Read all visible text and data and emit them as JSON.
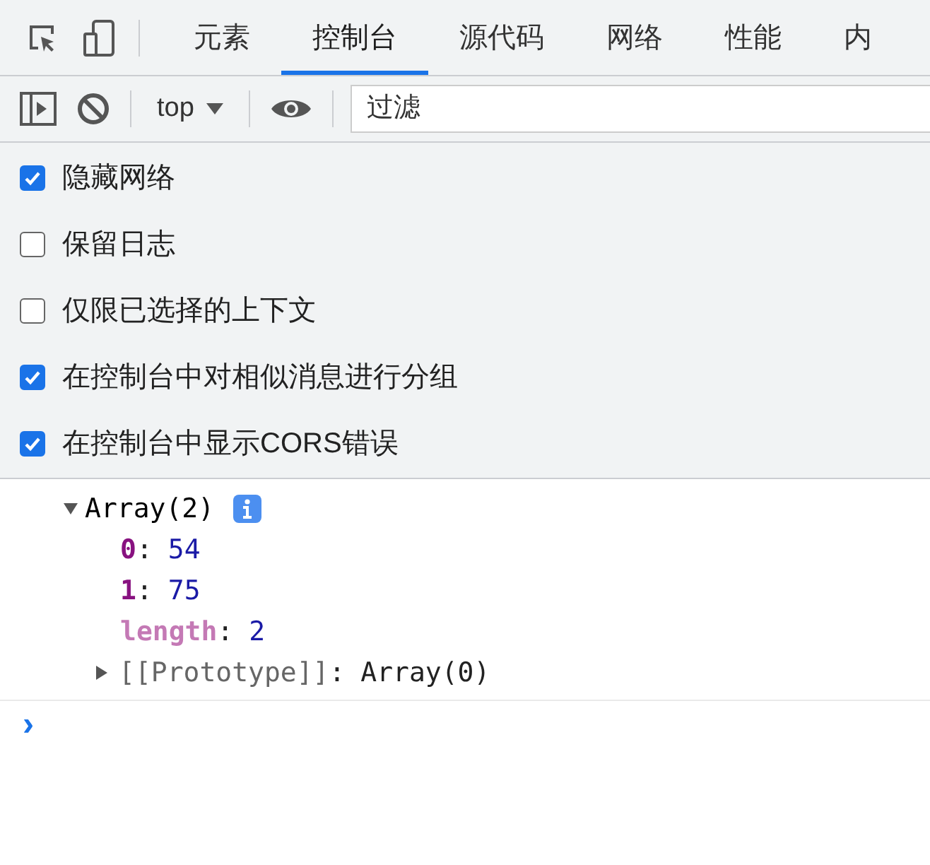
{
  "tabs": [
    {
      "label": "元素",
      "selected": false
    },
    {
      "label": "控制台",
      "selected": true
    },
    {
      "label": "源代码",
      "selected": false
    },
    {
      "label": "网络",
      "selected": false
    },
    {
      "label": "性能",
      "selected": false
    },
    {
      "label": "内",
      "selected": false
    }
  ],
  "toolbar": {
    "context": "top",
    "filter": {
      "placeholder": "过滤"
    }
  },
  "settings": [
    {
      "label": "隐藏网络",
      "checked": true
    },
    {
      "label": "保留日志",
      "checked": false
    },
    {
      "label": "仅限已选择的上下文",
      "checked": false
    },
    {
      "label": "在控制台中对相似消息进行分组",
      "checked": true
    },
    {
      "label": "在控制台中显示CORS错误",
      "checked": true
    }
  ],
  "console": {
    "entry": {
      "label": "Array(2)",
      "expanded": true,
      "separator": ":",
      "properties": [
        {
          "key": "0",
          "value": "54",
          "kind": "index"
        },
        {
          "key": "1",
          "value": "75",
          "kind": "index"
        },
        {
          "key": "length",
          "value": "2",
          "kind": "meta"
        }
      ],
      "prototype": {
        "key": "[[Prototype]]",
        "value": "Array(0)",
        "expanded": false
      }
    },
    "prompt": "›"
  }
}
